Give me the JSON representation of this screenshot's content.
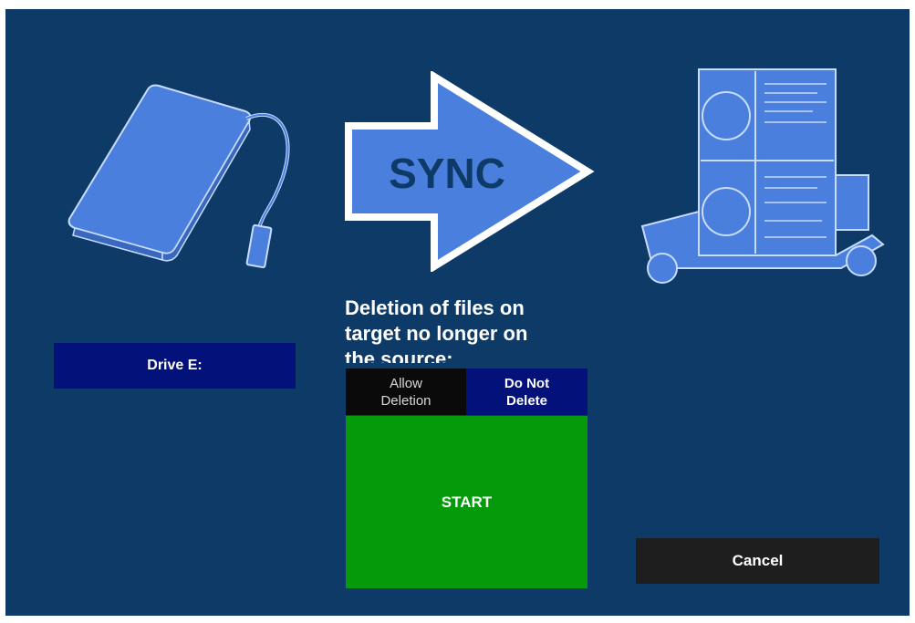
{
  "sync_graphic": {
    "label": "SYNC",
    "icon": "sync-arrow-icon"
  },
  "source": {
    "label": "Drive E:",
    "icon": "external-hard-drive-icon"
  },
  "target": {
    "icon": "server-cart-icon"
  },
  "deletion": {
    "prompt": "Deletion of files on\ntarget no longer on\nthe source:",
    "options": [
      {
        "line1": "Allow",
        "line2": "Deletion",
        "selected": false
      },
      {
        "line1": "Do Not",
        "line2": "Delete",
        "selected": true
      }
    ]
  },
  "actions": {
    "start_label": "START",
    "cancel_label": "Cancel"
  },
  "colors": {
    "background": "#0e3a68",
    "selected_option": "#03127a",
    "start": "#049a0a",
    "cancel": "#1e1e1e",
    "icon_fill": "#4a7fde"
  }
}
